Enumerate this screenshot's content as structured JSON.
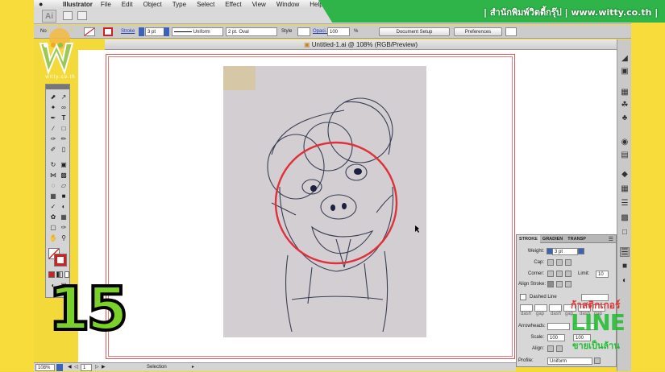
{
  "menubar": {
    "app_name": "Illustrator",
    "items": [
      "File",
      "Edit",
      "Object",
      "Type",
      "Select",
      "Effect",
      "View",
      "Window",
      "Help"
    ]
  },
  "banner": {
    "text": "| สำนักพิมพ์วิตตี้กรุ๊ป | www.witty.co.th |",
    "color": "#2fb44a"
  },
  "logo": {
    "text": "witty.co.th"
  },
  "controlbar": {
    "no_selection": "No",
    "stroke_label": "Stroke",
    "stroke_weight": "3 pt",
    "profile": "Uniform",
    "brush": "2 pt. Oval",
    "style_label": "Style",
    "opacity_label": "Opaci...",
    "opacity_value": "100",
    "percent": "%",
    "document_setup": "Document Setup",
    "preferences": "Preferences"
  },
  "document": {
    "title": "Untitled-1.ai @ 108% (RGB/Preview)"
  },
  "overlay": {
    "step_number": "15"
  },
  "stroke_panel": {
    "tabs": [
      "STROKE",
      "GRADIEN",
      "TRANSP"
    ],
    "weight_label": "Weight:",
    "weight_value": "3 pt",
    "cap_label": "Cap:",
    "corner_label": "Corner:",
    "limit_label": "Limit:",
    "limit_value": "10",
    "align_label": "Align Stroke:",
    "dashed_label": "Dashed Line",
    "dash_labels": [
      "dash",
      "gap",
      "dash",
      "gap",
      "dash",
      "gap"
    ],
    "arrowheads_label": "Arrowheads:",
    "scale_label": "Scale:",
    "scale_values": [
      "100",
      "100"
    ],
    "align2_label": "Align:",
    "profile_label": "Profile:",
    "profile_value": "Uniform"
  },
  "statusbar": {
    "zoom": "108%",
    "page": "1",
    "tool": "Selection"
  },
  "promo": {
    "line1": "ก้าสติกเกอร์",
    "line2": "LINE",
    "line3": "ขายเป็นล้าน"
  },
  "colors": {
    "accent_red": "#e0303a",
    "brand_green": "#2fb44a",
    "frame_yellow": "#f7dc3c"
  }
}
